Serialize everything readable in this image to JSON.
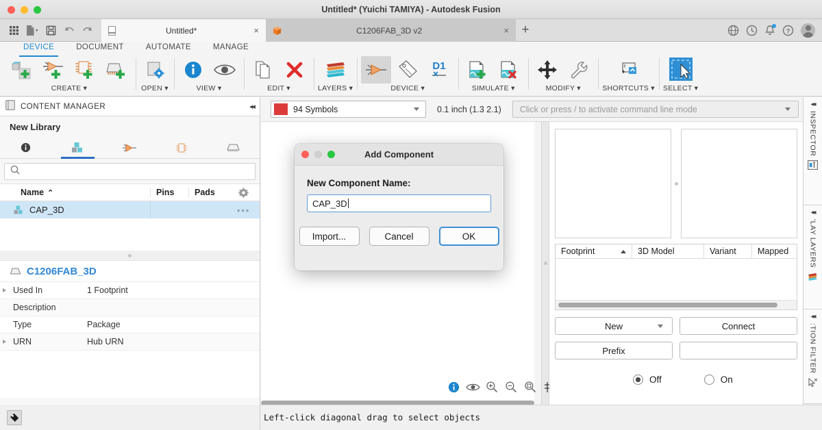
{
  "window": {
    "title": "Untitled* (Yuichi TAMIYA) - Autodesk Fusion"
  },
  "tabs": [
    {
      "label": "Untitled*",
      "icon": "document-icon",
      "active": true,
      "close": "×"
    },
    {
      "label": "C1206FAB_3D v2",
      "icon": "cube-icon",
      "active": false,
      "close": "×"
    }
  ],
  "tabstrip": {
    "new_tab_label": "+",
    "quick_access": [
      "grid-icon",
      "new-document-icon",
      "save-icon",
      "undo-icon",
      "redo-icon"
    ],
    "right_icons": [
      "globe-icon",
      "history-icon",
      "bell-icon",
      "help-icon",
      "avatar"
    ]
  },
  "ribbon": {
    "tabs": [
      {
        "label": "DEVICE",
        "active": true
      },
      {
        "label": "DOCUMENT",
        "active": false
      },
      {
        "label": "AUTOMATE",
        "active": false
      },
      {
        "label": "MANAGE",
        "active": false
      }
    ],
    "groups": [
      {
        "label": "CREATE ▾",
        "icons": [
          "add-package-icon",
          "add-symbol-icon",
          "add-device-icon",
          "add-3dpackage-icon"
        ]
      },
      {
        "label": "OPEN ▾",
        "icons": [
          "open-settings-icon"
        ]
      },
      {
        "label": "VIEW ▾",
        "icons": [
          "info-icon",
          "eye-icon"
        ]
      },
      {
        "label": "EDIT ▾",
        "icons": [
          "copy-icon",
          "delete-icon"
        ]
      },
      {
        "label": "LAYERS ▾",
        "icons": [
          "layers-icon"
        ]
      },
      {
        "label": "DEVICE ▾",
        "icons": [
          "symbol-icon",
          "tag-icon",
          "d1-icon"
        ]
      },
      {
        "label": "SIMULATE ▾",
        "icons": [
          "add-simulation-icon",
          "remove-simulation-icon"
        ]
      },
      {
        "label": "MODIFY ▾",
        "icons": [
          "move-icon",
          "wrench-icon"
        ]
      },
      {
        "label": "SHORTCUTS ▾",
        "icons": [
          "shortcuts-icon"
        ]
      },
      {
        "label": "SELECT ▾",
        "icons": [
          "select-icon"
        ]
      }
    ]
  },
  "content_manager": {
    "header": "CONTENT MANAGER",
    "collapse": "◂◂",
    "library_name": "New Library",
    "tabs": [
      {
        "name": "info-tab-icon",
        "active": false
      },
      {
        "name": "packages-tab-icon",
        "active": true
      },
      {
        "name": "symbols-tab-icon",
        "active": false
      },
      {
        "name": "devices-tab-icon",
        "active": false
      },
      {
        "name": "packages3d-tab-icon",
        "active": false
      }
    ],
    "search": {
      "value": "",
      "placeholder": ""
    },
    "table": {
      "columns": [
        "Name",
        "Pins",
        "Pads"
      ],
      "sort_indicator": "⌃",
      "rows": [
        {
          "name": "CAP_3D",
          "pins": "",
          "pads": "",
          "more": "•••",
          "selected": true
        }
      ]
    }
  },
  "details": {
    "title": "C1206FAB_3D",
    "rows": [
      {
        "key": "Used In",
        "value": "1 Footprint",
        "expandable": true
      },
      {
        "key": "Description",
        "value": "",
        "expandable": false
      },
      {
        "key": "Type",
        "value": "Package",
        "expandable": false
      },
      {
        "key": "URN",
        "value": "Hub URN",
        "expandable": true
      }
    ]
  },
  "command_bar": {
    "layer": {
      "label": "94 Symbols",
      "color": "#dd3b3b"
    },
    "grid_info": "0.1 inch (1.3 2.1)",
    "command_line_placeholder": "Click or press / to activate command line mode"
  },
  "canvas_tools": [
    {
      "name": "info-icon",
      "selected": false
    },
    {
      "name": "eye-icon",
      "selected": false
    },
    {
      "name": "zoom-in-icon",
      "selected": false
    },
    {
      "name": "zoom-out-icon",
      "selected": false
    },
    {
      "name": "zoom-fit-icon",
      "selected": false
    },
    {
      "name": "grid-icon",
      "selected": false
    },
    {
      "name": "crosshair-icon",
      "selected": false
    },
    {
      "name": "no-entry-icon",
      "selected": false
    },
    {
      "name": "marquee-select-icon",
      "selected": true
    }
  ],
  "right_panel": {
    "footprint_table": {
      "columns": [
        "Footprint",
        "3D Model",
        "Variant",
        "Mapped"
      ],
      "sort_indicator": "⌃",
      "rows": []
    },
    "buttons": {
      "new": "New",
      "connect": "Connect",
      "prefix": "Prefix",
      "prefix_value": ""
    },
    "radios": [
      {
        "label": "Off",
        "selected": true
      },
      {
        "label": "On",
        "selected": false
      }
    ]
  },
  "dock": [
    {
      "label": "INSPECTOR",
      "icon": "inspector-icon",
      "collapse": "◂◂"
    },
    {
      "label": "'LAY LAYERS",
      "icon": "display-layers-icon",
      "collapse": "◂◂"
    },
    {
      "label": ":TION FILTER",
      "icon": "selection-filter-icon",
      "collapse": "◂◂"
    }
  ],
  "status_bar": {
    "message": "Left-click diagonal drag to select objects",
    "tag_icon": "tag-icon"
  },
  "modal": {
    "title": "Add Component",
    "label": "New Component Name:",
    "input_value": "CAP_3D",
    "buttons": [
      {
        "label": "Import...",
        "primary": false
      },
      {
        "label": "Cancel",
        "primary": false
      },
      {
        "label": "OK",
        "primary": true
      }
    ]
  }
}
